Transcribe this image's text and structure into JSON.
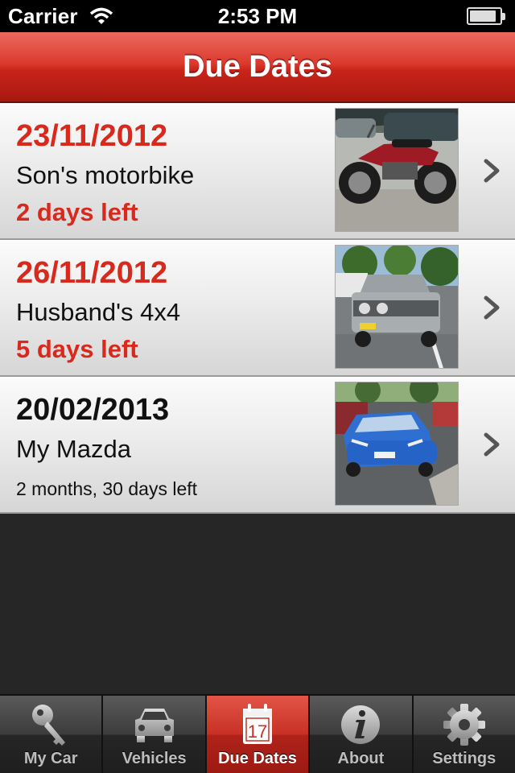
{
  "status_bar": {
    "carrier": "Carrier",
    "time": "2:53 PM",
    "battery_level": 0.9
  },
  "nav": {
    "title": "Due Dates"
  },
  "due_dates": [
    {
      "date": "23/11/2012",
      "name": "Son's motorbike",
      "remaining": "2 days left",
      "urgent": true,
      "photo": "motorbike-photo"
    },
    {
      "date": "26/11/2012",
      "name": "Husband's 4x4",
      "remaining": "5 days left",
      "urgent": true,
      "photo": "4x4-photo"
    },
    {
      "date": "20/02/2013",
      "name": "My Mazda",
      "remaining": "2 months, 30 days left",
      "urgent": false,
      "photo": "mazda-photo"
    }
  ],
  "tabs": [
    {
      "label": "My Car",
      "icon": "key-icon",
      "active": false
    },
    {
      "label": "Vehicles",
      "icon": "car-icon",
      "active": false
    },
    {
      "label": "Due Dates",
      "icon": "calendar-icon",
      "active": true,
      "calendar_day": "17"
    },
    {
      "label": "About",
      "icon": "info-icon",
      "active": false
    },
    {
      "label": "Settings",
      "icon": "gear-icon",
      "active": false
    }
  ],
  "colors": {
    "accent_red": "#d9281c",
    "nav_red": "#c9241a",
    "background": "#262626"
  }
}
